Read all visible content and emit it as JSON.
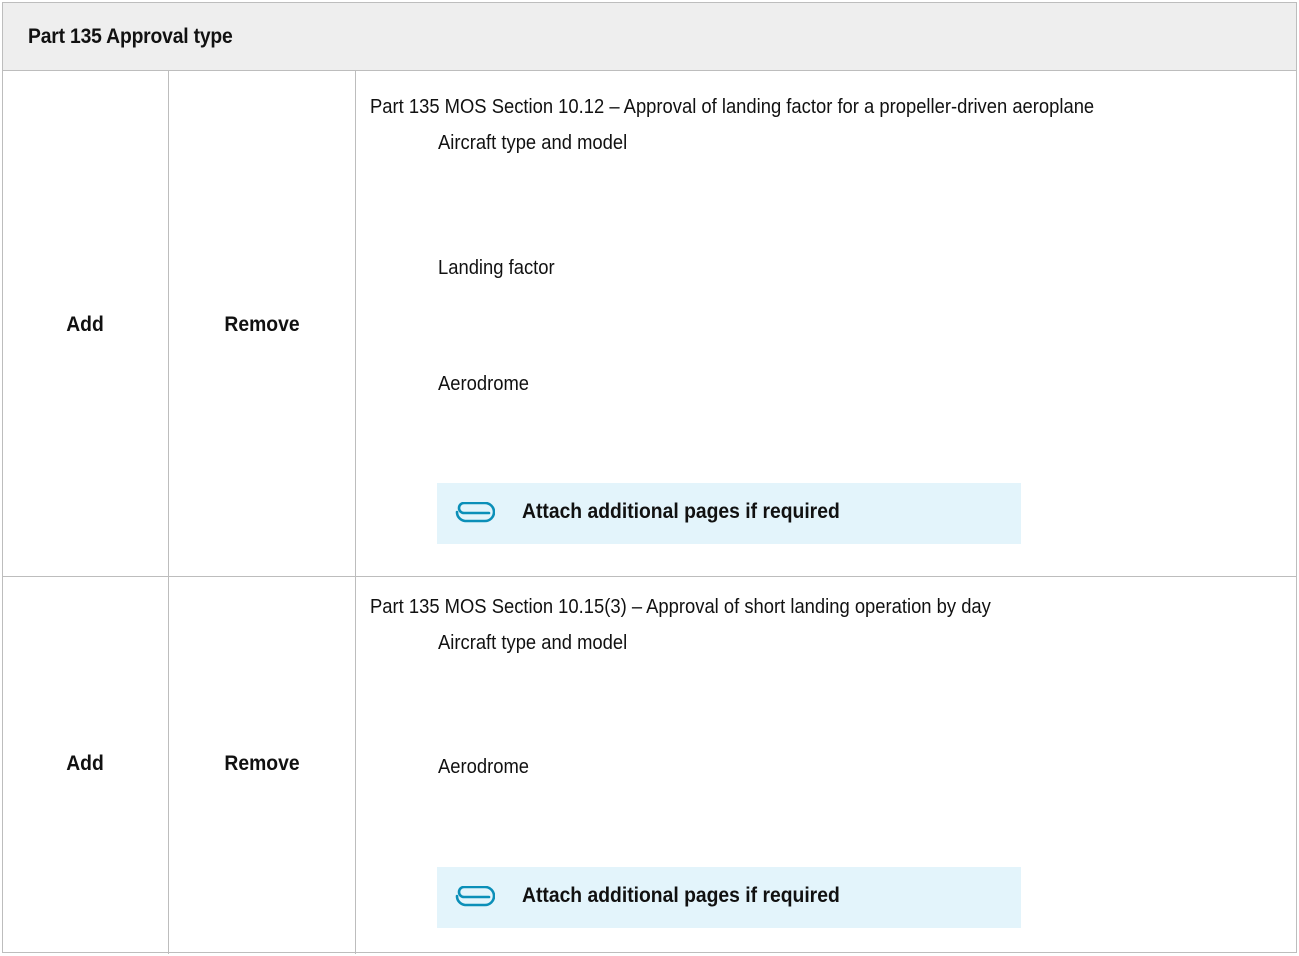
{
  "header": {
    "title": "Part 135 Approval type"
  },
  "rows": [
    {
      "add_label": "Add",
      "remove_label": "Remove",
      "section": "Part 135 MOS Section 10.12 – Approval of landing factor for a propeller-driven aeroplane",
      "fields": [
        "Aircraft type and model",
        "Landing factor",
        "Aerodrome"
      ],
      "attach_text": "Attach additional pages if required",
      "attach_icon": "paperclip-icon"
    },
    {
      "add_label": "Add",
      "remove_label": "Remove",
      "section": "Part 135 MOS Section 10.15(3) – Approval of short landing operation by day",
      "fields": [
        "Aircraft type and model",
        "Aerodrome"
      ],
      "attach_text": "Attach additional pages if required",
      "attach_icon": "paperclip-icon"
    }
  ],
  "colors": {
    "header_bg": "#eeeeee",
    "attach_bg": "#e3f4fb",
    "clip_icon": "#0b8fb8",
    "border": "#bdbdbd"
  }
}
